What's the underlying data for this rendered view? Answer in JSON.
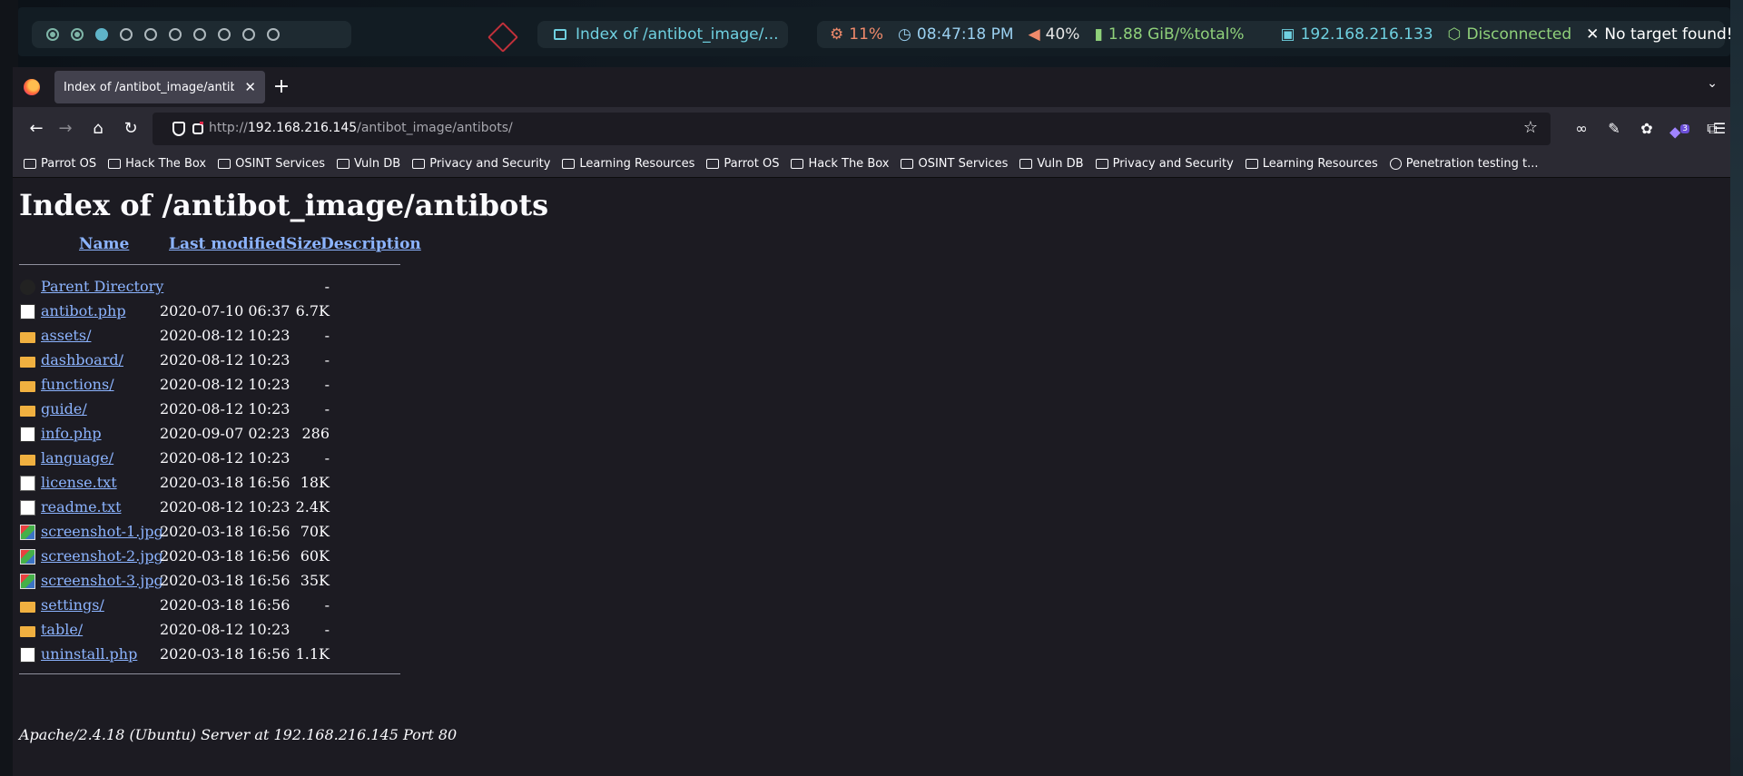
{
  "statusbar": {
    "workspaces": [
      "occupied",
      "occupied",
      "active",
      "empty",
      "empty",
      "empty",
      "empty",
      "empty",
      "empty",
      "empty"
    ],
    "window_title": "Index of /antibot_image/...",
    "cpu": "11%",
    "clock": "08:47:18 PM",
    "volume": "40%",
    "memory": "1.88 GiB/%total%",
    "ip": "192.168.216.133",
    "vpn": "Disconnected",
    "target": "No target found!",
    "colors": {
      "cpu": "#f08a6b",
      "clock": "#9ad0f0",
      "volume": "#e6e6e6",
      "memory": "#8fd07a",
      "ip": "#6fd0e0",
      "vpn": "#8fd07a",
      "target": "#ffffff"
    }
  },
  "browser": {
    "tab_title": "Index of /antibot_image/antib",
    "url_prefix": "http://",
    "url_host": "192.168.216.145",
    "url_path": "/antibot_image/antibots/",
    "extension_badge": "3",
    "bookmarks": [
      "Parrot OS",
      "Hack The Box",
      "OSINT Services",
      "Vuln DB",
      "Privacy and Security",
      "Learning Resources",
      "Parrot OS",
      "Hack The Box",
      "OSINT Services",
      "Vuln DB",
      "Privacy and Security",
      "Learning Resources"
    ],
    "bookmark_last": "Penetration testing t..."
  },
  "page": {
    "title": "Index of /antibot_image/antibots",
    "columns": {
      "name": "Name",
      "modified": "Last modified",
      "size": "Size",
      "description": "Description"
    },
    "entries": [
      {
        "icon": "parent",
        "name": "Parent Directory",
        "date": "",
        "size": "-"
      },
      {
        "icon": "file",
        "name": "antibot.php",
        "date": "2020-07-10 06:37",
        "size": "6.7K"
      },
      {
        "icon": "folder",
        "name": "assets/",
        "date": "2020-08-12 10:23",
        "size": "-"
      },
      {
        "icon": "folder",
        "name": "dashboard/",
        "date": "2020-08-12 10:23",
        "size": "-"
      },
      {
        "icon": "folder",
        "name": "functions/",
        "date": "2020-08-12 10:23",
        "size": "-"
      },
      {
        "icon": "folder",
        "name": "guide/",
        "date": "2020-08-12 10:23",
        "size": "-"
      },
      {
        "icon": "file",
        "name": "info.php",
        "date": "2020-09-07 02:23",
        "size": "286"
      },
      {
        "icon": "folder",
        "name": "language/",
        "date": "2020-08-12 10:23",
        "size": "-"
      },
      {
        "icon": "text",
        "name": "license.txt",
        "date": "2020-03-18 16:56",
        "size": "18K"
      },
      {
        "icon": "text",
        "name": "readme.txt",
        "date": "2020-08-12 10:23",
        "size": "2.4K"
      },
      {
        "icon": "image",
        "name": "screenshot-1.jpg",
        "date": "2020-03-18 16:56",
        "size": "70K"
      },
      {
        "icon": "image",
        "name": "screenshot-2.jpg",
        "date": "2020-03-18 16:56",
        "size": "60K"
      },
      {
        "icon": "image",
        "name": "screenshot-3.jpg",
        "date": "2020-03-18 16:56",
        "size": "35K"
      },
      {
        "icon": "folder",
        "name": "settings/",
        "date": "2020-03-18 16:56",
        "size": "-"
      },
      {
        "icon": "folder",
        "name": "table/",
        "date": "2020-08-12 10:23",
        "size": "-"
      },
      {
        "icon": "file",
        "name": "uninstall.php",
        "date": "2020-03-18 16:56",
        "size": "1.1K"
      }
    ],
    "footer": "Apache/2.4.18 (Ubuntu) Server at 192.168.216.145 Port 80"
  }
}
